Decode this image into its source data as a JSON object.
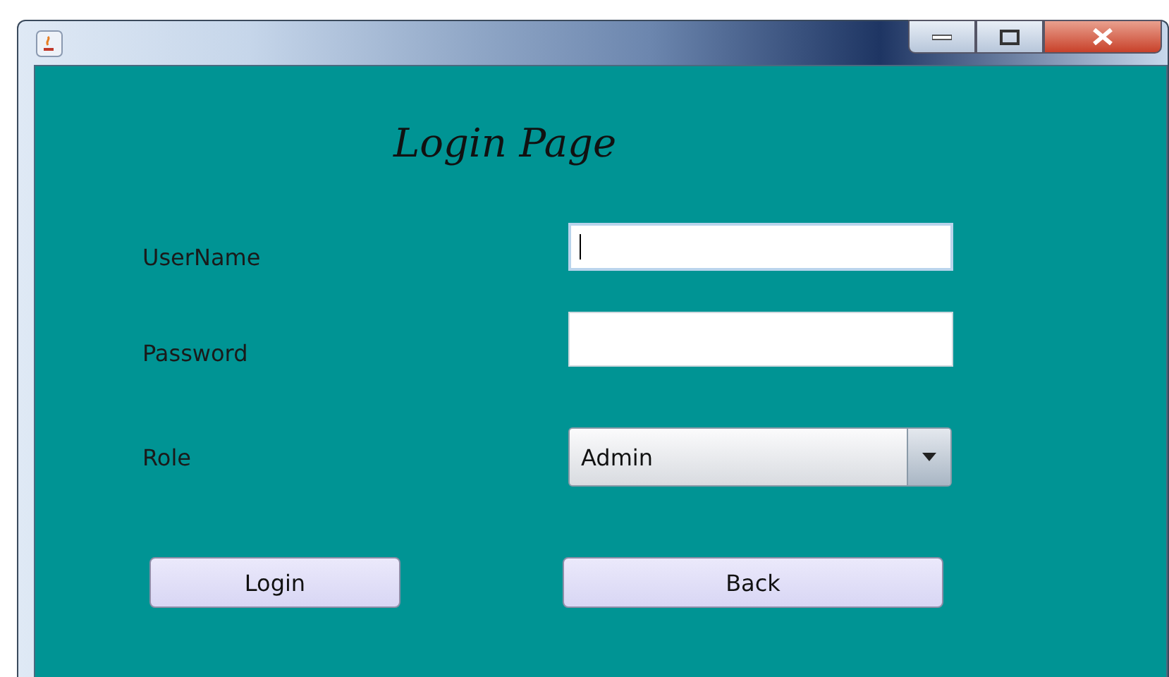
{
  "heading": "Login Page",
  "fields": [
    {
      "label": "UserName",
      "kind": "text",
      "focused": true
    },
    {
      "label": "Password",
      "kind": "password",
      "focused": false
    },
    {
      "label": "Role",
      "kind": "combo",
      "value": "Admin"
    }
  ],
  "buttons": [
    {
      "label": "Login"
    },
    {
      "label": "Back"
    }
  ]
}
